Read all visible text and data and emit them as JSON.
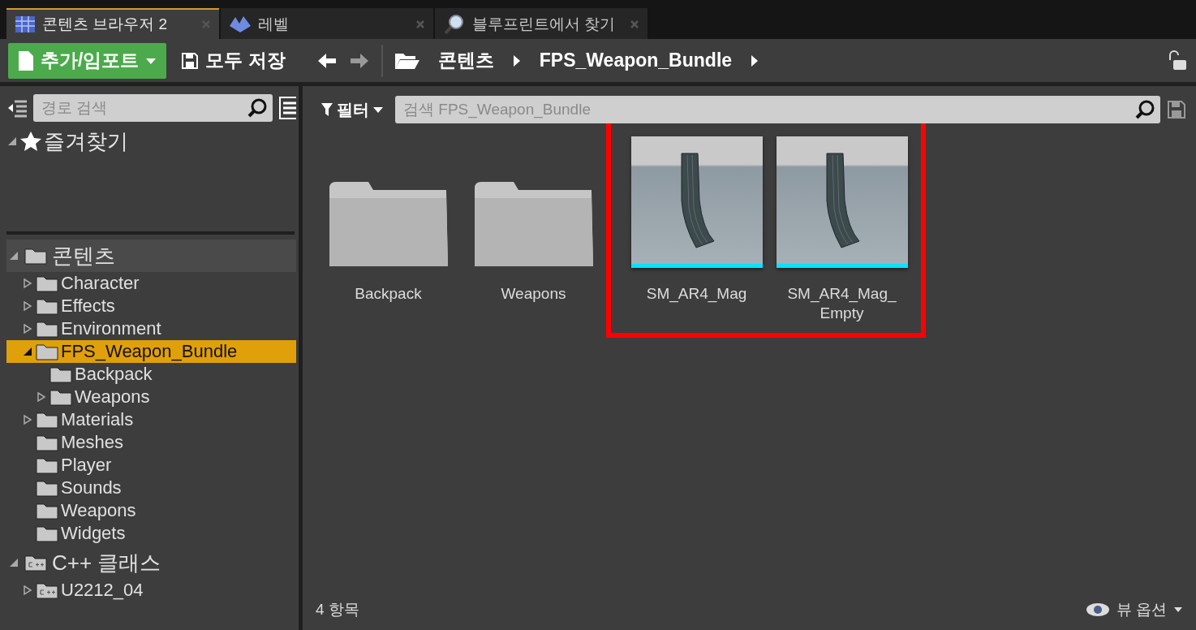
{
  "tabs": [
    {
      "label": "콘텐츠 브라우저 2",
      "kind": "grid",
      "selected": true
    },
    {
      "label": "레벨",
      "kind": "level",
      "selected": false
    },
    {
      "label": "블루프린트에서 찾기",
      "kind": "search",
      "selected": false
    }
  ],
  "toolbar": {
    "add_button": "추가/임포트",
    "save_all": "모두 저장",
    "breadcrumbs": [
      "콘텐츠",
      "FPS_Weapon_Bundle"
    ]
  },
  "sidebar": {
    "search": {
      "placeholder": "경로 검색"
    },
    "favorites": {
      "label": "즐겨찾기",
      "expanded": true
    },
    "tree": [
      {
        "label": "콘텐츠",
        "kind": "folder",
        "expandable": true,
        "expanded": true,
        "selected": false,
        "hovered": true,
        "children": [
          {
            "label": "Character",
            "kind": "folder",
            "expandable": true,
            "expanded": false,
            "selected": false,
            "hovered": false
          },
          {
            "label": "Effects",
            "kind": "folder",
            "expandable": true,
            "expanded": false,
            "selected": false,
            "hovered": false
          },
          {
            "label": "Environment",
            "kind": "folder",
            "expandable": true,
            "expanded": false,
            "selected": false,
            "hovered": false
          },
          {
            "label": "FPS_Weapon_Bundle",
            "kind": "folder",
            "expandable": true,
            "expanded": true,
            "selected": true,
            "hovered": false,
            "children": [
              {
                "label": "Backpack",
                "kind": "folder",
                "expandable": false,
                "expanded": false,
                "selected": false,
                "hovered": false
              },
              {
                "label": "Weapons",
                "kind": "folder",
                "expandable": true,
                "expanded": false,
                "selected": false,
                "hovered": false
              }
            ]
          },
          {
            "label": "Materials",
            "kind": "folder",
            "expandable": true,
            "expanded": false,
            "selected": false,
            "hovered": false
          },
          {
            "label": "Meshes",
            "kind": "folder",
            "expandable": false,
            "expanded": false,
            "selected": false,
            "hovered": false
          },
          {
            "label": "Player",
            "kind": "folder",
            "expandable": false,
            "expanded": false,
            "selected": false,
            "hovered": false
          },
          {
            "label": "Sounds",
            "kind": "folder",
            "expandable": false,
            "expanded": false,
            "selected": false,
            "hovered": false
          },
          {
            "label": "Weapons",
            "kind": "folder",
            "expandable": false,
            "expanded": false,
            "selected": false,
            "hovered": false
          },
          {
            "label": "Widgets",
            "kind": "folder",
            "expandable": false,
            "expanded": false,
            "selected": false,
            "hovered": false
          }
        ]
      },
      {
        "label": "C++ 클래스",
        "kind": "cpp",
        "expandable": true,
        "expanded": true,
        "selected": false,
        "hovered": false,
        "children": [
          {
            "label": "U2212_04",
            "kind": "cpp",
            "expandable": true,
            "expanded": false,
            "selected": false,
            "hovered": false
          }
        ]
      }
    ]
  },
  "content": {
    "filter": "필터",
    "search": {
      "placeholder": "검색 FPS_Weapon_Bundle"
    },
    "assets": [
      {
        "name": "Backpack",
        "kind": "folder",
        "highlighted": false
      },
      {
        "name": "Weapons",
        "kind": "folder",
        "highlighted": false
      },
      {
        "name": "SM_AR4_Mag",
        "kind": "mesh",
        "highlighted": true
      },
      {
        "name": "SM_AR4_Mag_ Empty",
        "kind": "mesh",
        "highlighted": true
      }
    ]
  },
  "status": {
    "count": "4 항목",
    "view_options": "뷰 옵션"
  }
}
